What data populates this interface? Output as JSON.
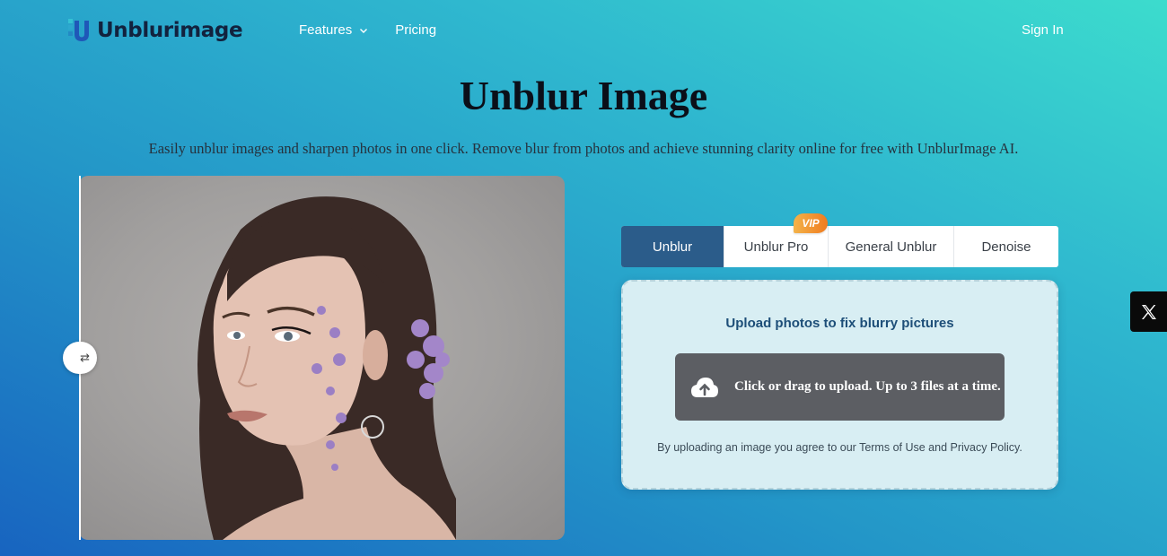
{
  "header": {
    "brand": "Unblurimage",
    "nav": [
      {
        "label": "Features",
        "has_dropdown": true
      },
      {
        "label": "Pricing",
        "has_dropdown": false
      }
    ],
    "sign_in": "Sign In"
  },
  "hero": {
    "title": "Unblur Image",
    "subtitle": "Easily unblur images and sharpen photos in one click. Remove blur from photos and achieve stunning clarity online for free with UnblurImage AI."
  },
  "tabs": [
    {
      "label": "Unblur",
      "active": true
    },
    {
      "label": "Unblur Pro",
      "active": false
    },
    {
      "label": "General Unblur",
      "active": false
    },
    {
      "label": "Denoise",
      "active": false
    }
  ],
  "vip_badge": "VIP",
  "upload": {
    "heading": "Upload photos to fix blurry pictures",
    "button_label": "Click or drag to upload. Up to 3 files at a time.",
    "note": "By uploading an image you agree to our Terms of Use and Privacy Policy."
  },
  "icons": {
    "logo": "unblurimage-logo-icon",
    "dropdown": "chevron-down-icon",
    "compare_handle": "compare-arrows-icon",
    "upload": "cloud-upload-icon",
    "share": "x-logo-icon"
  },
  "colors": {
    "active_tab": "#2b5c8a",
    "upload_button": "#5c5e63",
    "panel_bg": "#d8eef3",
    "vip_badge": "#f07b1f",
    "brand_text": "#12223e"
  }
}
